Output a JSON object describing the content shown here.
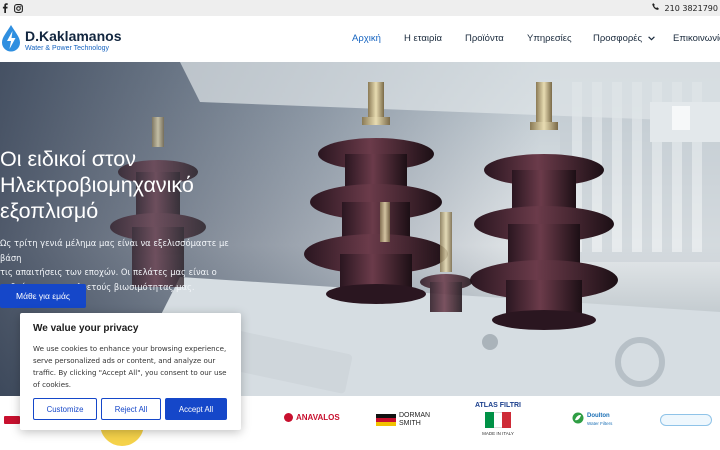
{
  "topbar": {
    "phone": "210 3821790",
    "social": [
      "facebook-icon",
      "instagram-icon"
    ]
  },
  "logo": {
    "brand": "D.Kaklamanos",
    "tagline": "Water & Power Technology"
  },
  "nav": {
    "items": [
      {
        "label": "Αρχική",
        "active": true
      },
      {
        "label": "Η εταιρία"
      },
      {
        "label": "Προϊόντα"
      },
      {
        "label": "Υπηρεσίες"
      },
      {
        "label": "Προσφορές",
        "has_dropdown": true
      },
      {
        "label": "Επικοινωνία"
      }
    ]
  },
  "hero": {
    "title_lines": [
      "Οι ειδικοί στον",
      "Ηλεκτροβιομηχανικό",
      "εξοπλισμό"
    ],
    "description_lines": [
      "Ως τρίτη γενιά μέλημα μας είναι να εξελισσόμαστε με βάση",
      "τις απαιτήσεις των εποχών. Οι πελάτες μας είναι ο",
      "καθρέφτης της πολυετούς βιωσιμότητας μας."
    ],
    "cta": "Μάθε για εμάς"
  },
  "partners": {
    "anavalos": "ANAVALOS",
    "dorman": [
      "DORMAN",
      "SMITH"
    ],
    "atlas": [
      "ATLAS FILTRI",
      "MADE IN ITALY"
    ],
    "doulton": [
      "Doulton",
      "Water Filters"
    ]
  },
  "cookie": {
    "title": "We value your privacy",
    "body_lines": [
      "We use cookies to enhance your browsing experience,",
      "serve personalized ads or content, and analyze our",
      "traffic. By clicking \"Accept All\", you consent to our use",
      "of cookies."
    ],
    "customize": "Customize",
    "reject": "Reject All",
    "accept": "Accept All"
  },
  "colors": {
    "accent": "#1547c9",
    "nav_active": "#1664c0",
    "brand_dark": "#12263f"
  }
}
